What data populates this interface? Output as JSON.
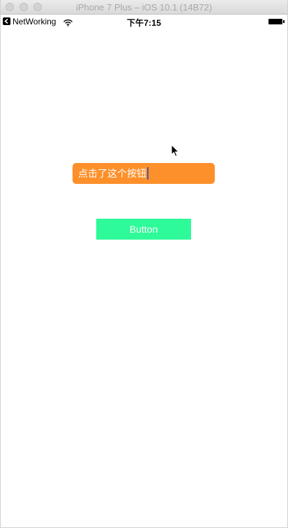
{
  "window": {
    "title": "iPhone 7 Plus – iOS 10.1 (14B72)"
  },
  "status_bar": {
    "carrier": "NetWorking",
    "time": "下午7:15",
    "icons": [
      "back-arrow-icon",
      "wifi-icon",
      "battery-icon"
    ]
  },
  "main": {
    "text_field_value": "点击了这个按钮",
    "text_field_color": "#fd902a",
    "button_label": "Button",
    "button_color": "#2ffa99"
  }
}
